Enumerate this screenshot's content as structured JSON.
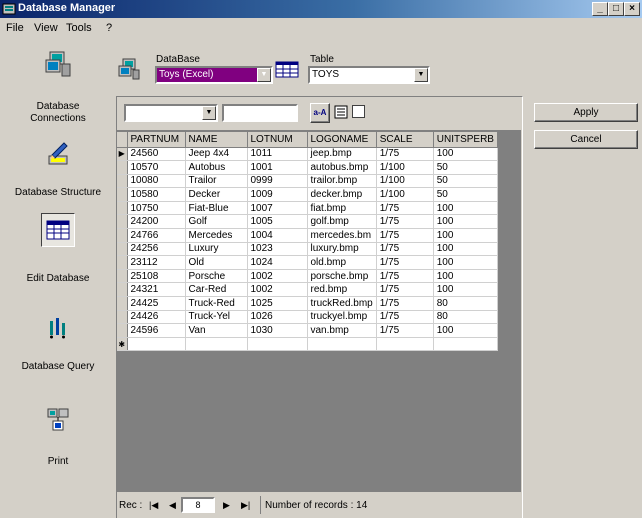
{
  "window": {
    "title": "Database Manager"
  },
  "menu": {
    "file": "File",
    "view": "View",
    "tools": "Tools",
    "help": "?"
  },
  "nav": {
    "connections": "Database\nConnections",
    "structure": "Database Structure",
    "edit": "Edit Database",
    "query": "Database Query",
    "print": "Print"
  },
  "selectors": {
    "database_label": "DataBase",
    "database_value": "Toys (Excel)",
    "table_label": "Table",
    "table_value": "TOYS"
  },
  "toolbar": {
    "sort_label": "a-A"
  },
  "buttons": {
    "apply": "Apply",
    "cancel": "Cancel"
  },
  "grid": {
    "columns": [
      "PARTNUM",
      "NAME",
      "LOTNUM",
      "LOGONAME",
      "SCALE",
      "UNITSPERB"
    ],
    "rows": [
      [
        "24560",
        "Jeep 4x4",
        "1011",
        "jeep.bmp",
        "1/75",
        "100"
      ],
      [
        "10570",
        "Autobus",
        "1001",
        "autobus.bmp",
        "1/100",
        "50"
      ],
      [
        "10080",
        "Trailor",
        "0999",
        "trailor.bmp",
        "1/100",
        "50"
      ],
      [
        "10580",
        "Decker",
        "1009",
        "decker.bmp",
        "1/100",
        "50"
      ],
      [
        "10750",
        "Fiat-Blue",
        "1007",
        "fiat.bmp",
        "1/75",
        "100"
      ],
      [
        "24200",
        "Golf",
        "1005",
        "golf.bmp",
        "1/75",
        "100"
      ],
      [
        "24766",
        "Mercedes",
        "1004",
        "mercedes.bm",
        "1/75",
        "100"
      ],
      [
        "24256",
        "Luxury",
        "1023",
        "luxury.bmp",
        "1/75",
        "100"
      ],
      [
        "23112",
        "Old",
        "1024",
        "old.bmp",
        "1/75",
        "100"
      ],
      [
        "25108",
        "Porsche",
        "1002",
        "porsche.bmp",
        "1/75",
        "100"
      ],
      [
        "24321",
        "Car-Red",
        "1002",
        "red.bmp",
        "1/75",
        "100"
      ],
      [
        "24425",
        "Truck-Red",
        "1025",
        "truckRed.bmp",
        "1/75",
        "80"
      ],
      [
        "24426",
        "Truck-Yel",
        "1026",
        "truckyel.bmp",
        "1/75",
        "80"
      ],
      [
        "24596",
        "Van",
        "1030",
        "van.bmp",
        "1/75",
        "100"
      ]
    ]
  },
  "status": {
    "rec_label": "Rec :",
    "current_record": "8",
    "record_count": "Number of records : 14"
  }
}
